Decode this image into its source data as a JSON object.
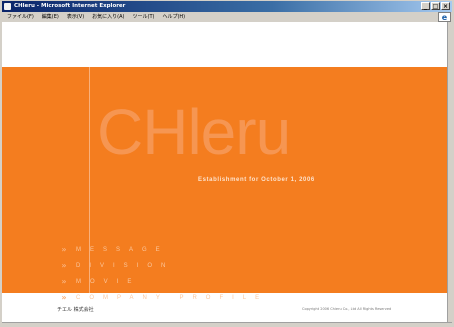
{
  "window": {
    "title": "CHleru - Microsoft Internet Explorer",
    "controls": {
      "minimize": "_",
      "maximize": "□",
      "close": "×"
    }
  },
  "menubar": {
    "items": [
      "ファイル(F)",
      "編集(E)",
      "表示(V)",
      "お気に入り(A)",
      "ツール(T)",
      "ヘルプ(H)"
    ]
  },
  "page": {
    "logo": "CHleru",
    "establishment": "Establishment for October 1, 2006",
    "nav_items": [
      "MESSAGE",
      "DIVISION",
      "MOVIE",
      "COMPANY PROFILE"
    ],
    "bullet": "»",
    "company_name": "チエル 株式会社",
    "copyright": "Copyright 2006 Chieru Co., Ltd All Rights Reserved"
  },
  "colors": {
    "orange": "#f47d1f",
    "logo_tint": "#f69652",
    "titlebar_start": "#0a246a"
  }
}
